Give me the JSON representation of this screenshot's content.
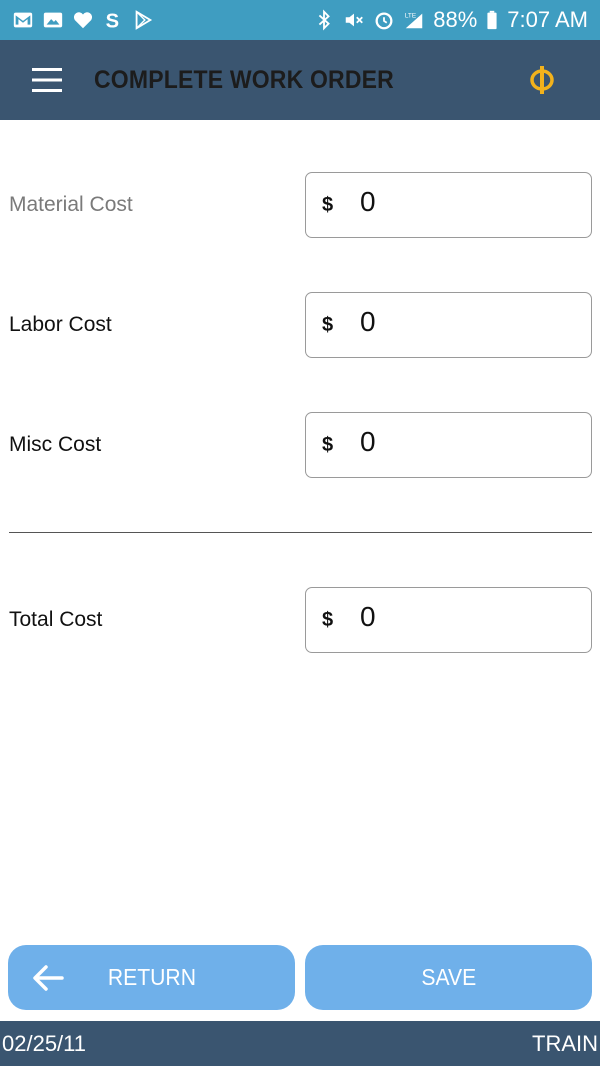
{
  "status_bar": {
    "battery": "88%",
    "time": "7:07 AM",
    "left_icons": [
      "gmail-icon",
      "gallery-icon",
      "heart-icon",
      "s-app-icon",
      "play-store-icon"
    ],
    "right_icons": [
      "bluetooth-icon",
      "mute-icon",
      "alarm-icon",
      "lte-signal-icon",
      "battery-icon"
    ]
  },
  "app_bar": {
    "title": "COMPLETE WORK ORDER",
    "menu_icon": "hamburger-menu-icon",
    "brand_icon": "phi-logo-icon",
    "brand_color": "#f2b21c",
    "background": "#3a5570"
  },
  "form": {
    "material": {
      "label": "Material Cost",
      "currency": "$",
      "value": "0"
    },
    "labor": {
      "label": "Labor Cost",
      "currency": "$",
      "value": "0"
    },
    "misc": {
      "label": "Misc Cost",
      "currency": "$",
      "value": "0"
    },
    "total": {
      "label": "Total Cost",
      "currency": "$",
      "value": "0"
    }
  },
  "buttons": {
    "return_label": "RETURN",
    "save_label": "SAVE",
    "button_color": "#6fb0ea"
  },
  "footer": {
    "date": "02/25/11",
    "mode": "TRAIN"
  }
}
